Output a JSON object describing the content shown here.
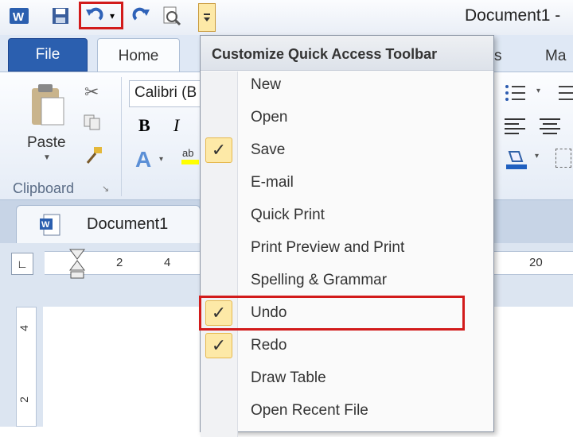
{
  "qat": {
    "app_icon": "word-icon",
    "doc_title": "Document1 -"
  },
  "ribbon": {
    "tabs": [
      "File",
      "Home"
    ],
    "partial_tabs": [
      "s",
      "Ma"
    ],
    "clipboard": {
      "paste_label": "Paste",
      "group_label": "Clipboard"
    },
    "font_name": "Calibri (B",
    "bold": "B",
    "italic": "I"
  },
  "doc_tab": {
    "label": "Document1"
  },
  "ruler": {
    "marks": [
      "2",
      "4",
      "20"
    ]
  },
  "vruler": {
    "marks": [
      "4",
      "2"
    ]
  },
  "menu": {
    "title": "Customize Quick Access Toolbar",
    "items": [
      {
        "label": "New",
        "checked": false
      },
      {
        "label": "Open",
        "checked": false
      },
      {
        "label": "Save",
        "checked": true
      },
      {
        "label": "E-mail",
        "checked": false
      },
      {
        "label": "Quick Print",
        "checked": false
      },
      {
        "label": "Print Preview and Print",
        "checked": false
      },
      {
        "label": "Spelling & Grammar",
        "checked": false
      },
      {
        "label": "Undo",
        "checked": true,
        "highlighted": true
      },
      {
        "label": "Redo",
        "checked": true
      },
      {
        "label": "Draw Table",
        "checked": false
      },
      {
        "label": "Open Recent File",
        "checked": false
      }
    ],
    "checkmark": "✓"
  },
  "colors": {
    "accent": "#d21b1b",
    "file_tab": "#2b5faf",
    "check_bg": "#fde9a7"
  }
}
